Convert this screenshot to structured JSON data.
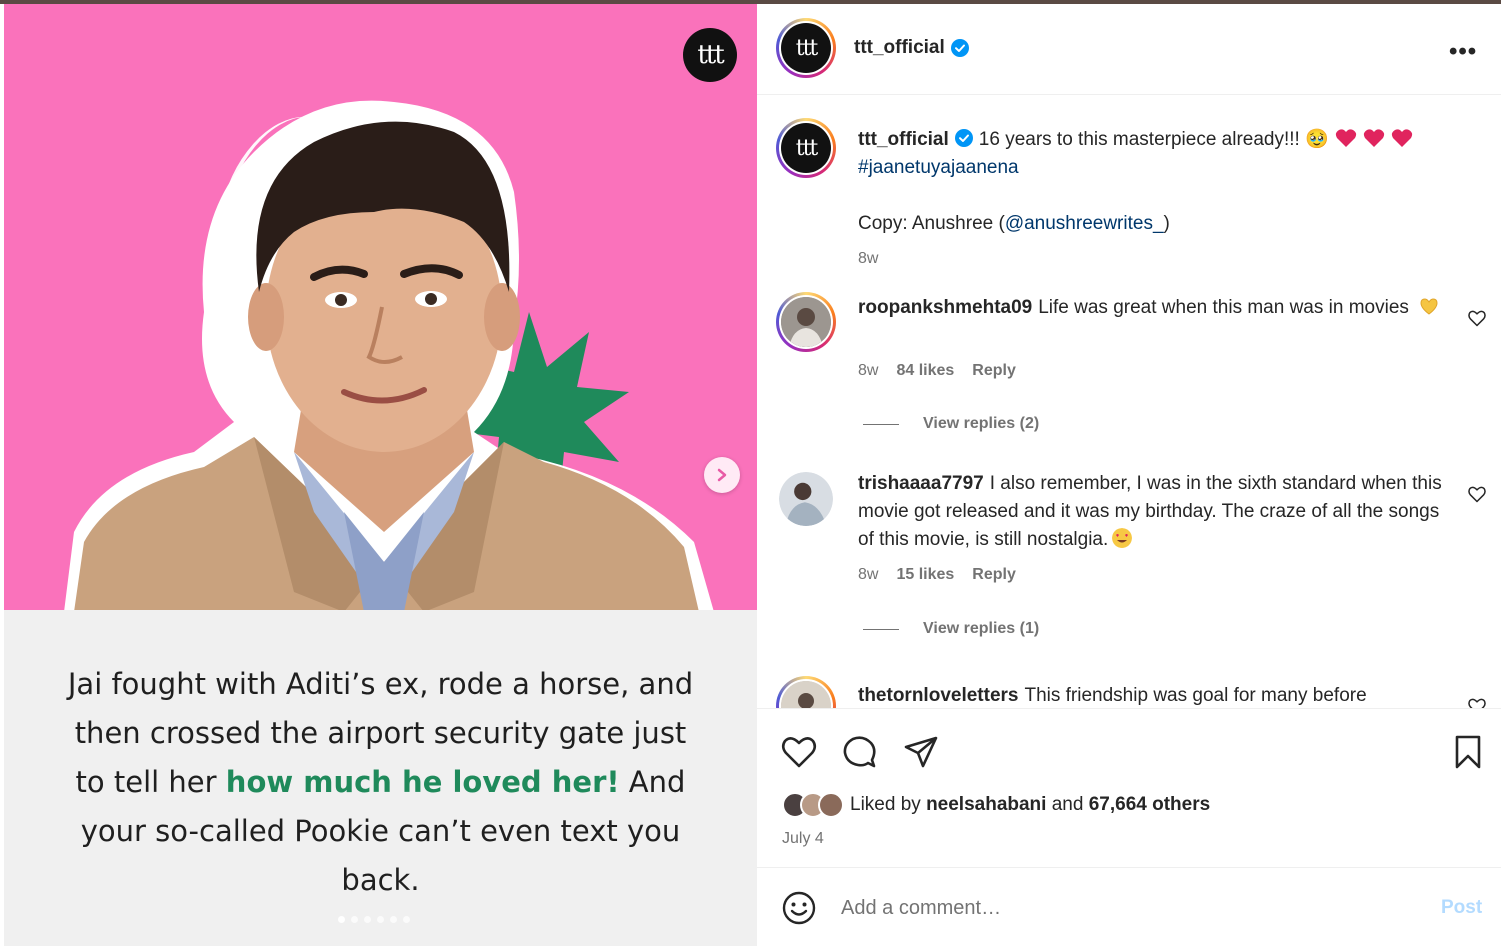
{
  "media": {
    "brand_badge": "ttt",
    "caption_parts": {
      "before": "Jai fought with Aditi’s ex, rode a horse, and then crossed the airport security gate just to tell her ",
      "highlight": "how much he loved her!",
      "after": " And your so-called Pookie can’t even text you back."
    },
    "carousel": {
      "total": 6,
      "active": 0
    },
    "colors": {
      "background_pink": "#fa72bb",
      "burst_green": "#1f8a5b",
      "bottom_bg": "#f0f0f0"
    }
  },
  "header": {
    "avatar_text": "ttt",
    "username": "ttt_official",
    "more_label": "•••"
  },
  "post_caption": {
    "avatar_text": "ttt",
    "username": "ttt_official",
    "text": "16 years to this masterpiece already!!! 🥹",
    "hashtag": "#jaanetuyajaanena",
    "copy_prefix": "Copy: Anushree (",
    "mention": "@anushreewrites_",
    "copy_suffix": ")",
    "age": "8w"
  },
  "comments": [
    {
      "username": "roopankshmehta09",
      "text": "Life was great when this man was in movies",
      "age": "8w",
      "likes": "84 likes",
      "reply": "Reply",
      "view_replies": "View replies (2)"
    },
    {
      "username": "trishaaaa7797",
      "text": "I also remember, I was in the sixth standard when this movie got released and it was my birthday. The craze of all the songs of this movie, is still nostalgia.",
      "age": "8w",
      "likes": "15 likes",
      "reply": "Reply",
      "view_replies": "View replies (1)"
    },
    {
      "username": "thetornloveletters",
      "text": "This friendship was goal for many before"
    }
  ],
  "actions": {
    "liked_by_prefix": "Liked by",
    "liked_by_user": "neelsahabani",
    "and": "and",
    "others": "67,664 others",
    "date": "July 4"
  },
  "composer": {
    "placeholder": "Add a comment…",
    "post_label": "Post"
  }
}
